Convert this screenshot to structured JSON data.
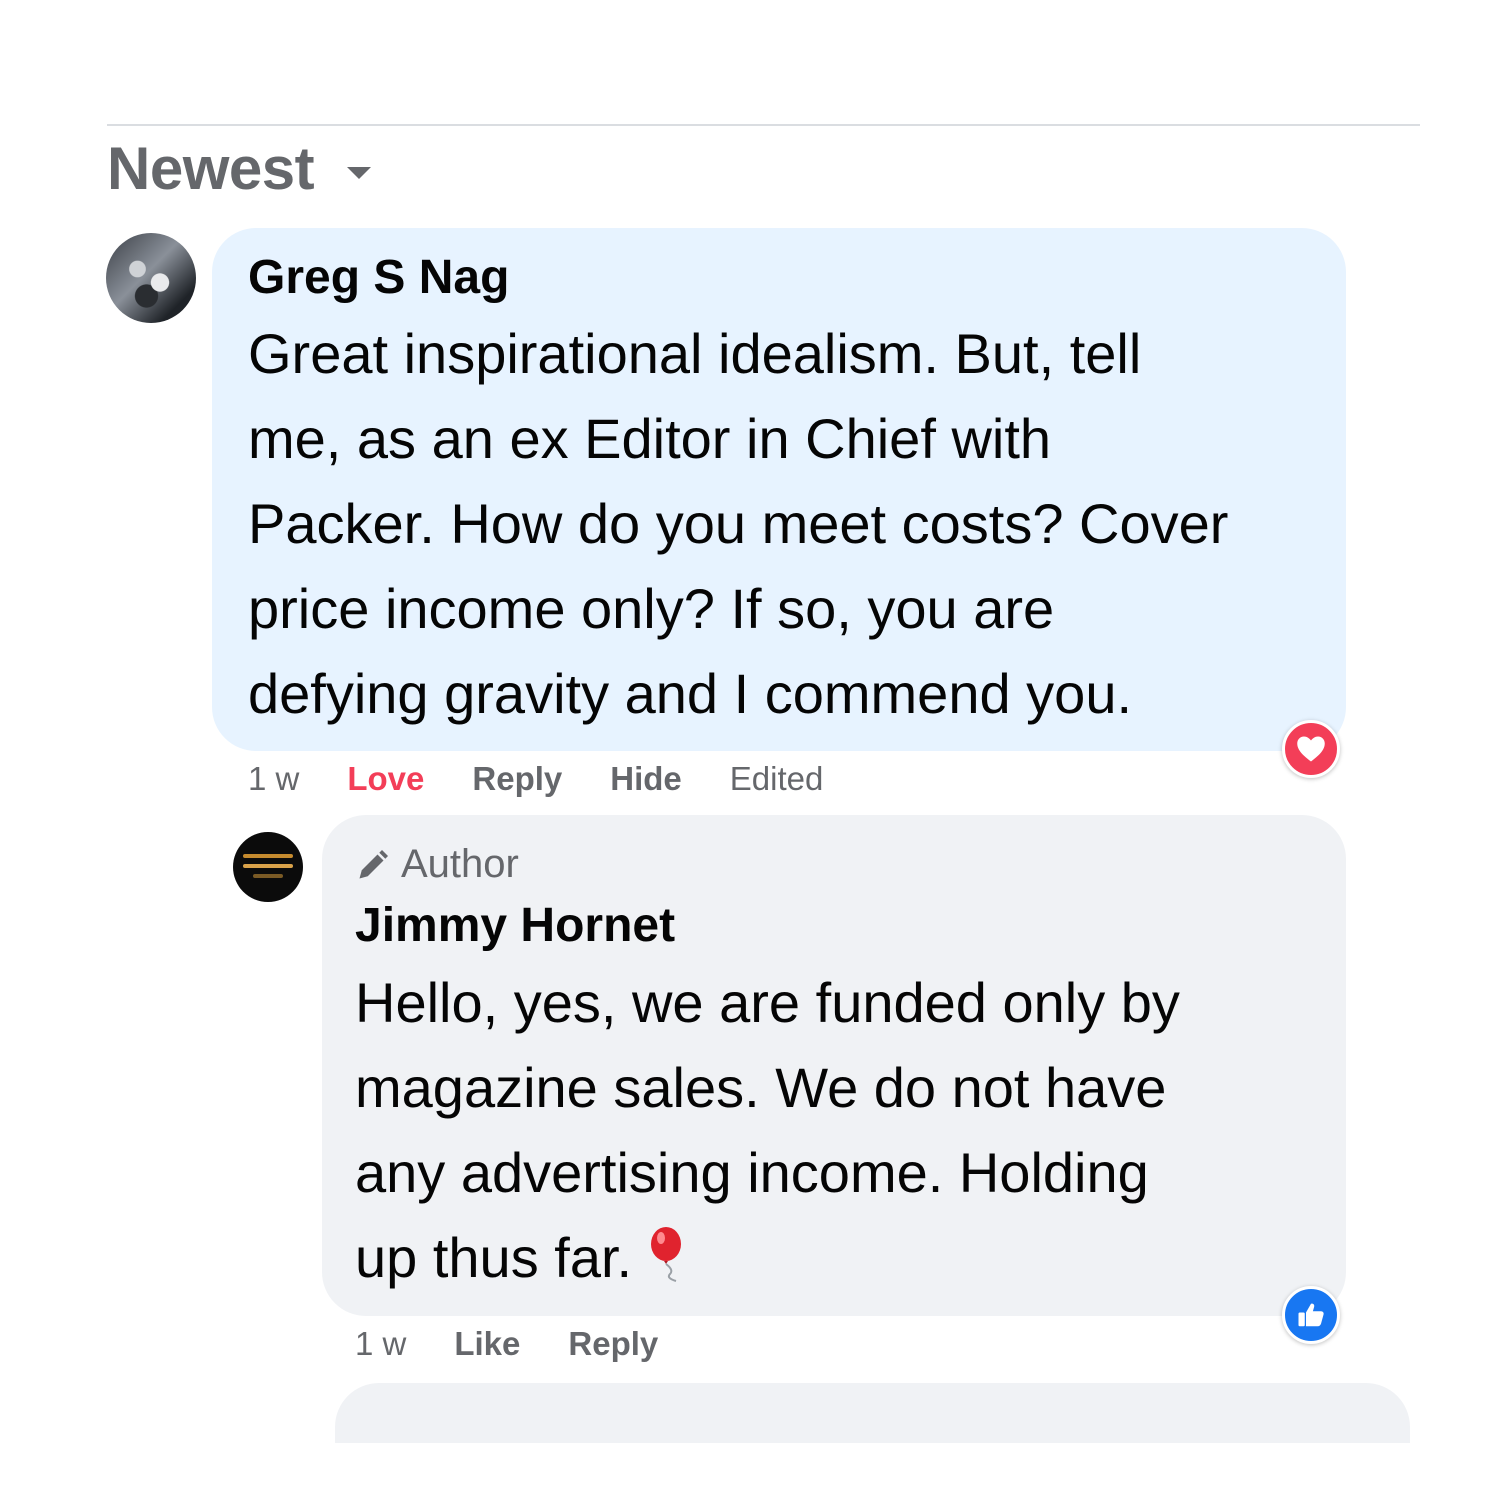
{
  "sort": {
    "label": "Newest"
  },
  "comment": {
    "author": "Greg S Nag",
    "lines": [
      "Great inspirational idealism. But, tell",
      "me, as an ex Editor in Chief with",
      "Packer. How do you meet costs? Cover",
      "price income only? If so, you are",
      "defying gravity and I commend you."
    ],
    "reaction_icon": "heart-icon",
    "actions": {
      "time": "1 w",
      "love": "Love",
      "reply": "Reply",
      "hide": "Hide",
      "edited": "Edited"
    }
  },
  "reply": {
    "badge": "Author",
    "badge_icon": "pen-icon",
    "author": "Jimmy Hornet",
    "lines": [
      "Hello, yes, we are funded only by",
      "magazine sales. We do not have",
      "any advertising income. Holding",
      "up thus far."
    ],
    "emoji": "balloon-icon",
    "reaction_icon": "thumbs-up-icon",
    "actions": {
      "time": "1 w",
      "like": "Like",
      "reply": "Reply"
    }
  },
  "colors": {
    "comment_bubble": "#e7f3ff",
    "reply_bubble": "#f0f2f5",
    "love": "#f33e58",
    "like": "#1877f2",
    "secondary_text": "#65676b"
  }
}
